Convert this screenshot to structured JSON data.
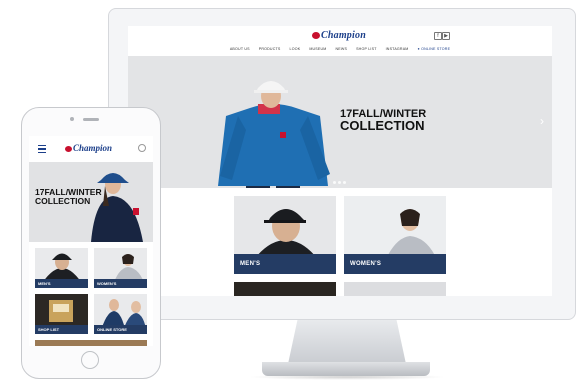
{
  "desktop": {
    "logo": "Champion",
    "nav": [
      "ABOUT US",
      "PRODUCTS",
      "LOOK",
      "MUSEUM",
      "NEWS",
      "SHOP LIST",
      "INSTAGRAM"
    ],
    "nav_online": "● ONLINE STORE",
    "social": [
      "f",
      "▶"
    ],
    "hero": {
      "line1": "17FALL/WINTER",
      "line2": "COLLECTION",
      "arrow": "›"
    },
    "tiles": [
      {
        "label": "MEN'S"
      },
      {
        "label": "WOMEN'S"
      }
    ]
  },
  "mobile": {
    "logo": "Champion",
    "hero": {
      "line1": "17FALL/WINTER",
      "line2": "COLLECTION"
    },
    "tiles": [
      {
        "label": "MEN'S"
      },
      {
        "label": "WOMEN'S"
      },
      {
        "label": "SHOP LIST"
      },
      {
        "label": "ONLINE STORE"
      }
    ]
  },
  "colors": {
    "brand_navy": "#1c3f8a",
    "brand_red": "#c8102e",
    "label_bg": "#243c64",
    "hoodie_blue": "#1f6fb3"
  },
  "icons": [
    "hamburger-menu-icon",
    "search-icon",
    "facebook-icon",
    "youtube-icon",
    "chevron-right-icon"
  ]
}
